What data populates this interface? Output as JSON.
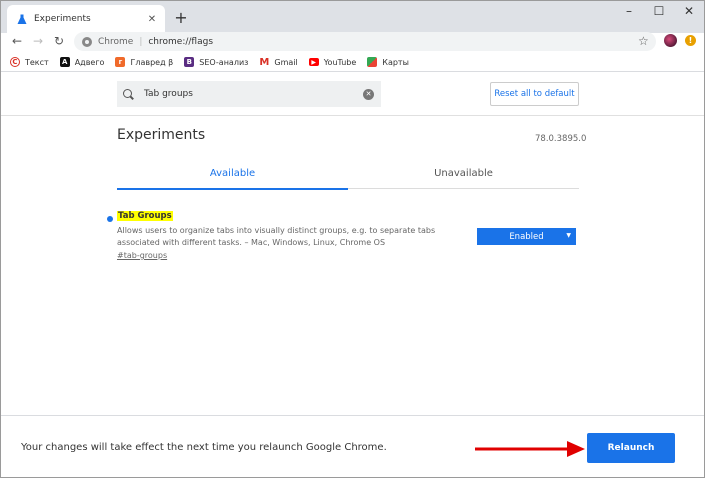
{
  "browser": {
    "tab_title": "Experiments",
    "omnibox": {
      "site": "Chrome",
      "url": "chrome://flags"
    },
    "bookmarks": [
      {
        "label": "Текст",
        "icon": "copyright-icon",
        "color": "#d93025"
      },
      {
        "label": "Адвего",
        "icon": "advego-icon",
        "color": "#111111"
      },
      {
        "label": "Главред β",
        "icon": "glavred-icon",
        "color": "#f06a2a"
      },
      {
        "label": "SEO-анализ",
        "icon": "seo-icon",
        "color": "#5a2d82"
      },
      {
        "label": "Gmail",
        "icon": "gmail-icon",
        "color": "#d93025"
      },
      {
        "label": "YouTube",
        "icon": "youtube-icon",
        "color": "#ff0000"
      },
      {
        "label": "Карты",
        "icon": "maps-icon",
        "color": "#34a853"
      }
    ]
  },
  "flags_page": {
    "search_value": "Tab groups",
    "reset_label": "Reset all to default",
    "heading": "Experiments",
    "version": "78.0.3895.0",
    "tabs": {
      "available": "Available",
      "unavailable": "Unavailable"
    },
    "flag": {
      "name": "Tab Groups",
      "description": "Allows users to organize tabs into visually distinct groups, e.g. to separate tabs associated with different tasks. – Mac, Windows, Linux, Chrome OS",
      "hash": "#tab-groups",
      "selected": "Enabled"
    }
  },
  "relaunch_bar": {
    "message": "Your changes will take effect the next time you relaunch Google Chrome.",
    "button": "Relaunch"
  },
  "colors": {
    "accent": "#1a73e8",
    "highlight": "#ffff00",
    "arrow": "#e00000"
  }
}
